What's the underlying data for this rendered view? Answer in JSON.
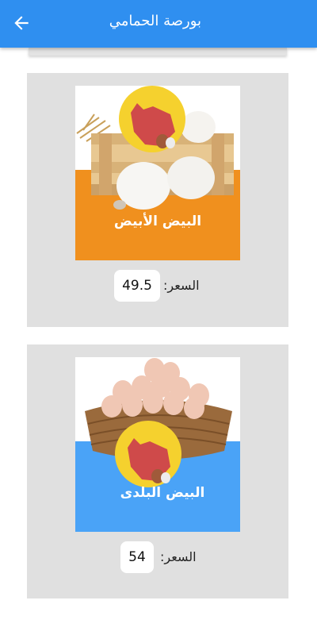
{
  "app_bar": {
    "title": "بورصة الحمامي",
    "back_icon": "arrow-left-icon",
    "color": "#2f8ff0"
  },
  "products": [
    {
      "image_caption": "البيض الأبيض",
      "price_label": "السعر:",
      "price_value": "49.5",
      "banner_color": "#f0901e"
    },
    {
      "image_caption": "البيض البلدى",
      "price_label": "السعر:",
      "price_value": "54",
      "banner_color": "#4aa3f7"
    }
  ]
}
